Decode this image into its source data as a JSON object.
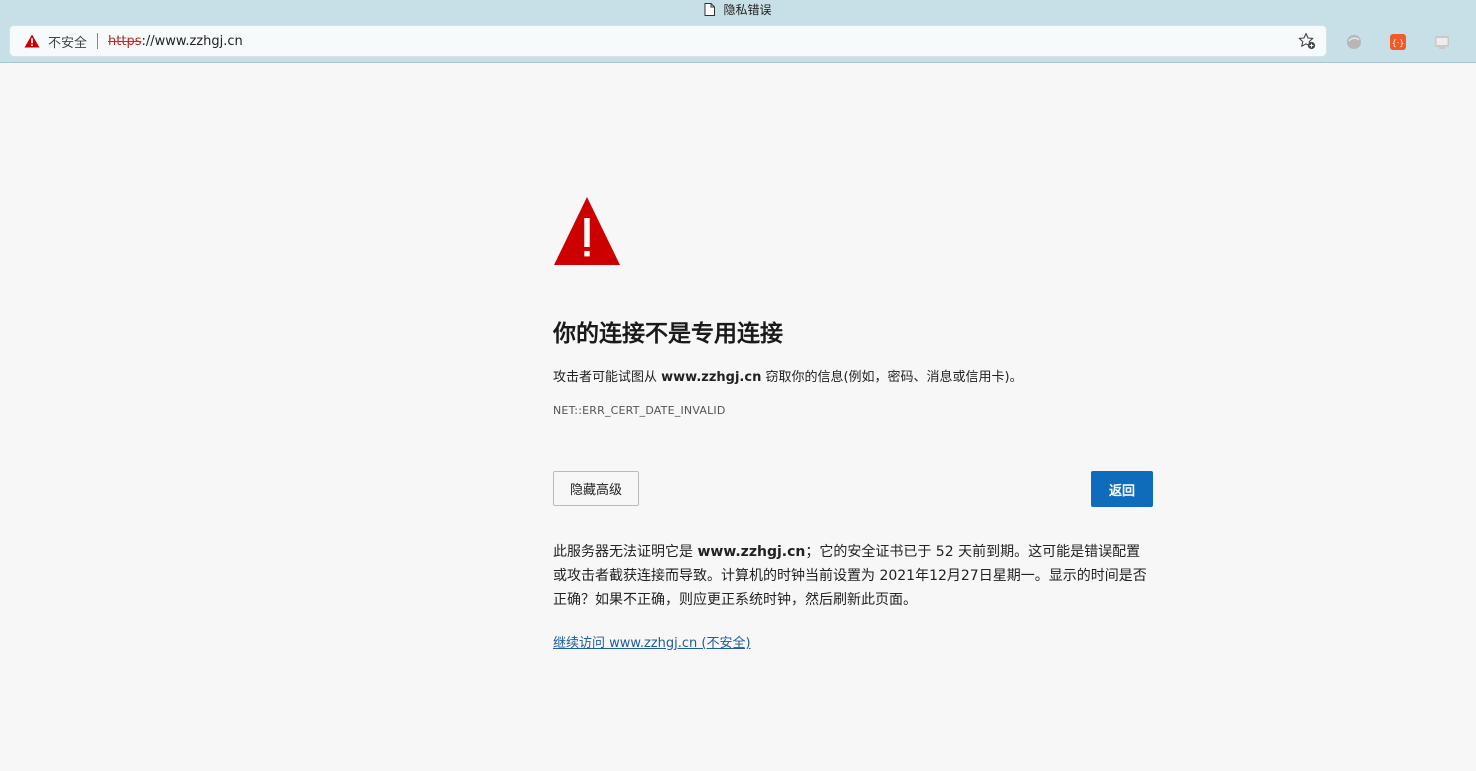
{
  "window": {
    "title": "隐私错误",
    "icon": "document-icon"
  },
  "address_bar": {
    "security_label": "不安全",
    "security_icon": "warning-triangle-icon",
    "url_scheme": "https",
    "url_rest": "://www.zzhgj.cn",
    "favorite_icon": "add-favorite-icon"
  },
  "extensions": [
    {
      "name": "extension-gray-icon"
    },
    {
      "name": "extension-orange-icon"
    },
    {
      "name": "extension-window-icon"
    }
  ],
  "page": {
    "warning_icon": "warning-triangle-icon",
    "heading": "你的连接不是专用连接",
    "lead_before": "攻击者可能试图从 ",
    "lead_domain": "www.zzhgj.cn",
    "lead_after": " 窃取你的信息(例如，密码、消息或信用卡)。",
    "error_code": "NET::ERR_CERT_DATE_INVALID",
    "hide_advanced_label": "隐藏高级",
    "back_label": "返回",
    "details_before": "此服务器无法证明它是 ",
    "details_domain": "www.zzhgj.cn",
    "details_after": "；它的安全证书已于 52 天前到期。这可能是错误配置或攻击者截获连接而导致。计算机的时钟当前设置为 2021年12月27日星期一。显示的时间是否正确？如果不正确，则应更正系统时钟，然后刷新此页面。",
    "proceed_link": "继续访问 www.zzhgj.cn (不安全)"
  },
  "colors": {
    "accent_button": "#0f6cbd",
    "warning_red": "#cc0000",
    "toolbar_bg": "#c7dfe6",
    "page_bg": "#f7f7f7"
  }
}
